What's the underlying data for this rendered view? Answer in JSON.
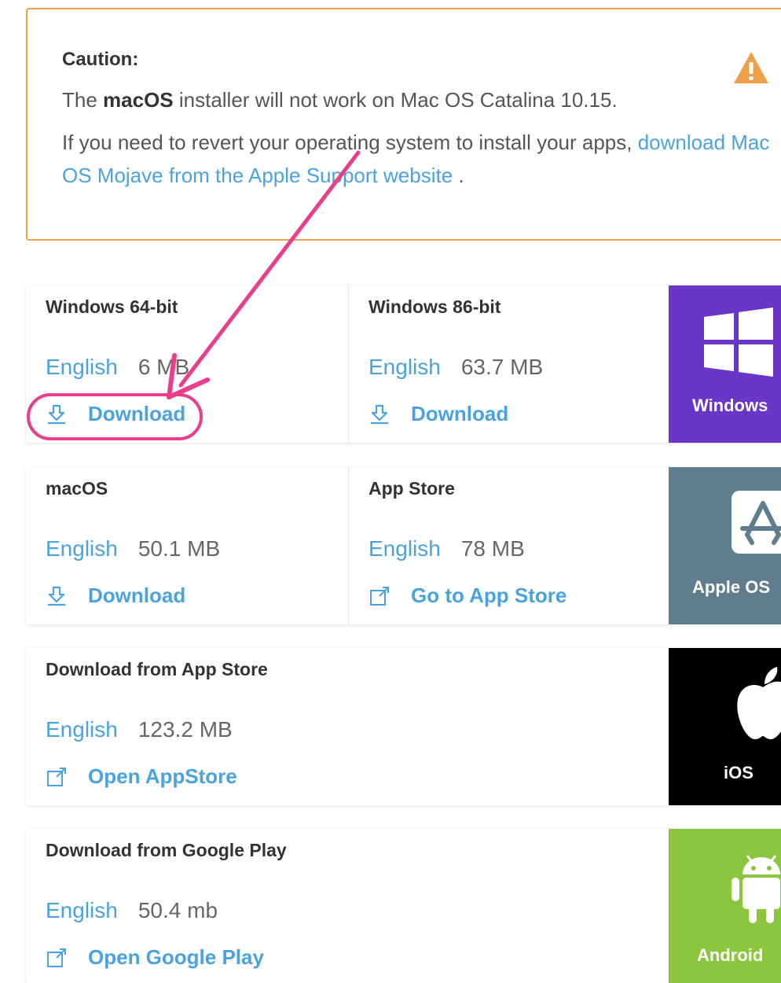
{
  "caution": {
    "title": "Caution:",
    "line1_pre": "The ",
    "line1_bold": "macOS",
    "line1_post": " installer will not work on Mac OS Catalina 10.15.",
    "line2_text": "If you need to revert your operating system to install your apps, ",
    "line2_link": "download Mac OS Mojave from the Apple Support website",
    "line2_end": " .",
    "icon": "warning-icon"
  },
  "cards": {
    "windows": {
      "platform_label": "Windows",
      "platform_icon": "windows-logo-icon",
      "platform_color": "#6b35c8",
      "left": {
        "title": "Windows 64-bit",
        "language": "English",
        "size": "6  MB",
        "action": "Download",
        "action_icon": "download-icon"
      },
      "right": {
        "title": "Windows 86-bit",
        "language": "English",
        "size": "63.7 MB",
        "action": "Download",
        "action_icon": "download-icon"
      }
    },
    "apple": {
      "platform_label": "Apple OS",
      "platform_icon": "app-store-icon",
      "platform_color": "#5f7d8e",
      "left": {
        "title": "macOS",
        "language": "English",
        "size": "50.1 MB",
        "action": "Download",
        "action_icon": "download-icon"
      },
      "right": {
        "title": "App Store",
        "language": "English",
        "size": "78 MB",
        "action": "Go to App Store",
        "action_icon": "external-link-icon"
      }
    },
    "ios": {
      "platform_label": "iOS",
      "platform_icon": "apple-logo-icon",
      "platform_color": "#000000",
      "main": {
        "title": "Download from App Store",
        "language": "English",
        "size": "123.2 MB",
        "action": "Open AppStore",
        "action_icon": "external-link-icon"
      }
    },
    "android": {
      "platform_label": "Android",
      "platform_icon": "android-logo-icon",
      "platform_color": "#8cc63f",
      "main": {
        "title": "Download from Google Play",
        "language": "English",
        "size": "50.4 mb",
        "action": "Open Google Play",
        "action_icon": "external-link-icon"
      }
    }
  },
  "colors": {
    "accent": "#4aa3df",
    "caution_border": "#f0a04b",
    "annotation": "#e83e8c"
  }
}
